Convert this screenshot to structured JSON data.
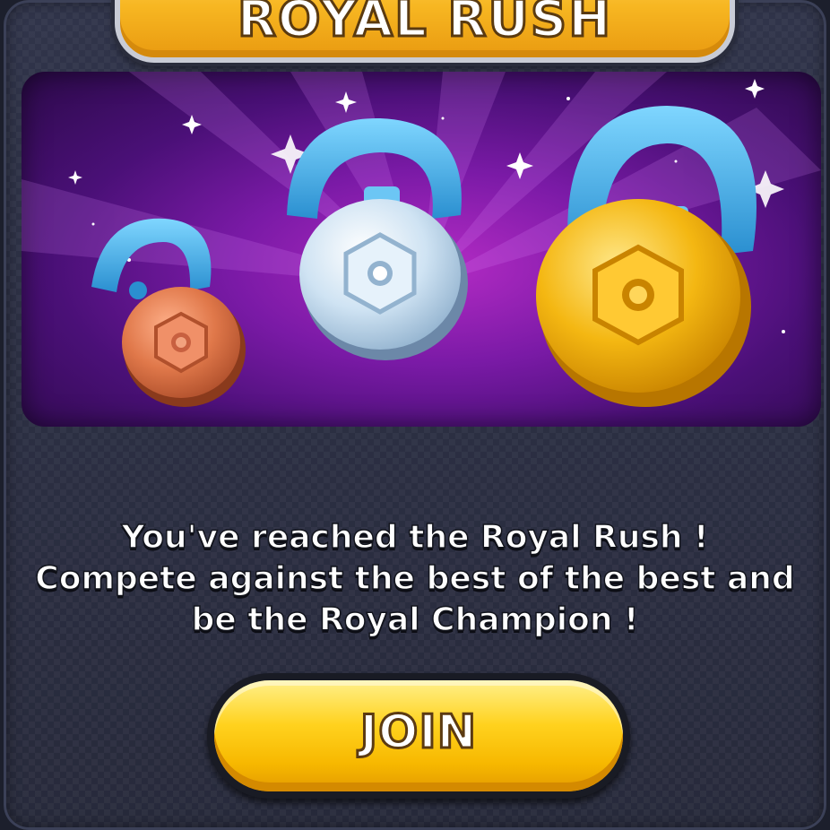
{
  "header": {
    "title": "ROYAL RUSH"
  },
  "artwork": {
    "medals": [
      {
        "name": "bronze-medal",
        "color": "#e0784a"
      },
      {
        "name": "silver-medal",
        "color": "#cfe3f3"
      },
      {
        "name": "gold-medal",
        "color": "#f4b712"
      }
    ],
    "ribbon_color": "#45b8ee",
    "background_color": "#8a1fb0"
  },
  "message": {
    "line1": "You've reached the Royal Rush !",
    "line2": "Compete against the best of the best and",
    "line3": "be the Royal Champion !"
  },
  "actions": {
    "join_label": "JOIN"
  }
}
